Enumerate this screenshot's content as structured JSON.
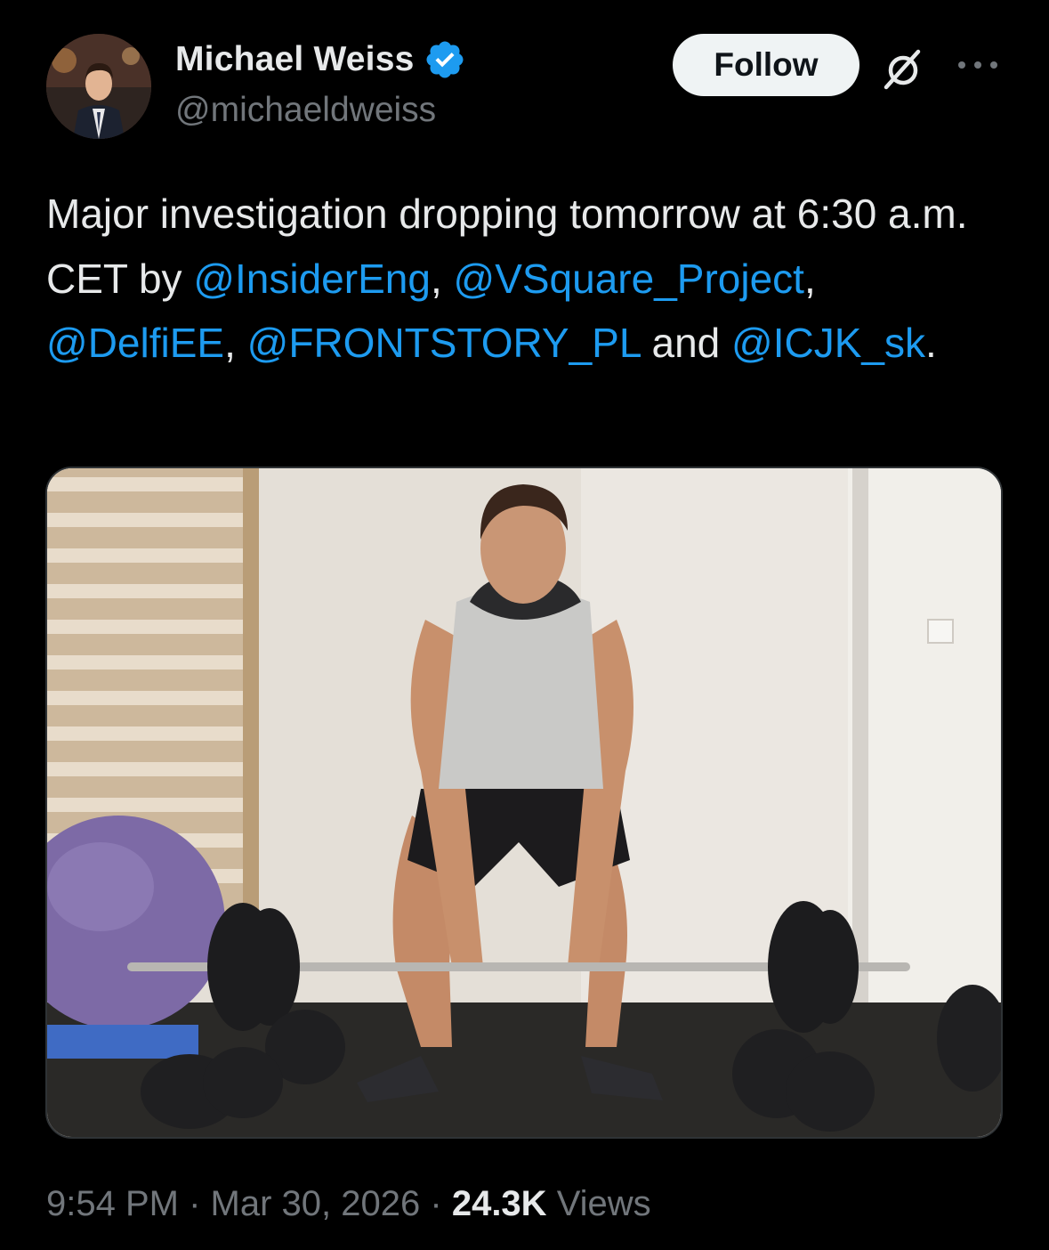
{
  "author": {
    "display_name": "Michael Weiss",
    "handle": "@michaeldweiss",
    "verified": true,
    "verified_badge_color": "#1d9bf0"
  },
  "actions": {
    "follow_label": "Follow",
    "grok_icon": "grok-icon",
    "more_icon": "more-icon"
  },
  "tweet": {
    "segments": [
      {
        "text": "Major investigation dropping tomorrow at 6:30 a.m. CET by ",
        "type": "text"
      },
      {
        "text": "@InsiderEng",
        "type": "mention"
      },
      {
        "text": ", ",
        "type": "text"
      },
      {
        "text": "@VSquare_Project",
        "type": "mention"
      },
      {
        "text": ", ",
        "type": "text"
      },
      {
        "text": "@DelfiEE",
        "type": "mention"
      },
      {
        "text": ", ",
        "type": "text"
      },
      {
        "text": "@FRONTSTORY_PL",
        "type": "mention"
      },
      {
        "text": " and ",
        "type": "text"
      },
      {
        "text": "@ICJK_sk",
        "type": "mention"
      },
      {
        "text": ".",
        "type": "text"
      }
    ]
  },
  "meta": {
    "time": "9:54 PM",
    "separator": "·",
    "date": "Mar 30, 2026",
    "views_count": "24.3K",
    "views_label": "Views"
  },
  "colors": {
    "background": "#000000",
    "text_primary": "#e7e9ea",
    "text_secondary": "#71767b",
    "link": "#1d9bf0",
    "follow_bg": "#eff3f4"
  }
}
